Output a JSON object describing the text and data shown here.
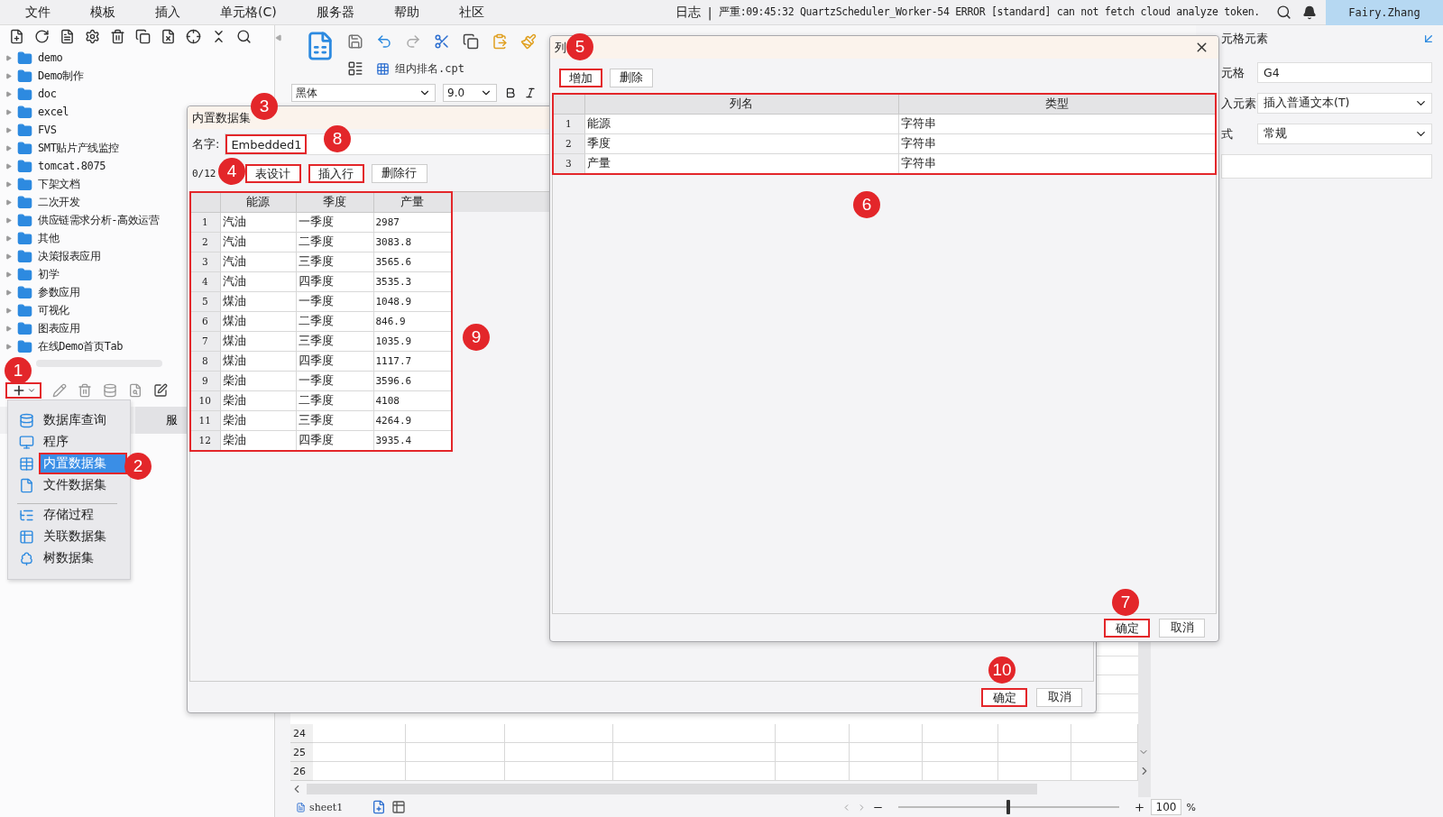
{
  "menu_bar": {
    "items": [
      "文件",
      "模板",
      "插入",
      "单元格(C)",
      "服务器",
      "帮助",
      "社区"
    ],
    "log_label": "日志",
    "separator": "|",
    "log_message": "严重:09:45:32 QuartzScheduler_Worker-54 ERROR [standard] can not fetch cloud analyze token.",
    "user": "Fairy.Zhang"
  },
  "file_tree": {
    "items": [
      {
        "name": "demo"
      },
      {
        "name": "Demo制作"
      },
      {
        "name": "doc"
      },
      {
        "name": "excel"
      },
      {
        "name": "FVS"
      },
      {
        "name": "SMT贴片产线监控"
      },
      {
        "name": "tomcat.8075"
      },
      {
        "name": "下架文档"
      },
      {
        "name": "二次开发"
      },
      {
        "name": "供应链需求分析-高效运营"
      },
      {
        "name": "其他"
      },
      {
        "name": "决策报表应用"
      },
      {
        "name": "初学"
      },
      {
        "name": "参数应用"
      },
      {
        "name": "可视化"
      },
      {
        "name": "图表应用"
      },
      {
        "name": "在线Demo首页Tab"
      }
    ]
  },
  "datasource_toolbar": {
    "add_highlighted": true,
    "tab_label": "服"
  },
  "new_dataset_menu": {
    "groups": [
      [
        {
          "label": "数据库查询",
          "selected": false,
          "highlighted": false
        },
        {
          "label": "程序",
          "selected": false,
          "highlighted": false
        },
        {
          "label": "内置数据集",
          "selected": true,
          "highlighted": true
        },
        {
          "label": "文件数据集",
          "selected": false,
          "highlighted": false
        }
      ],
      [
        {
          "label": "存储过程",
          "selected": false,
          "highlighted": false
        },
        {
          "label": "关联数据集",
          "selected": false,
          "highlighted": false
        },
        {
          "label": "树数据集",
          "selected": false,
          "highlighted": false
        }
      ]
    ]
  },
  "designer": {
    "file_tab": "组内排名.cpt",
    "font": "黑体",
    "font_size": "9.0",
    "row_numbers": [
      "24",
      "25",
      "26"
    ],
    "sheet_tab": "sheet1",
    "zoom_slider": {
      "level": 0.5
    },
    "zoom_value": "100",
    "zoom_unit": "%"
  },
  "cell_panel": {
    "title": "元格元素",
    "fields": [
      {
        "kind": "text",
        "label": "元格",
        "value": "G4"
      },
      {
        "kind": "select",
        "label": "入元素",
        "value": "插入普通文本(T)"
      },
      {
        "kind": "select",
        "label": "式",
        "value": "常规"
      },
      {
        "kind": "blank"
      }
    ]
  },
  "embedded_dialog": {
    "title": "内置数据集",
    "name_label": "名字:",
    "name_value": "Embedded1",
    "name_highlighted": true,
    "row_count": "0/12",
    "buttons": [
      {
        "label": "表设计",
        "highlighted": true
      },
      {
        "label": "插入行",
        "highlighted": true
      },
      {
        "label": "删除行",
        "highlighted": false
      }
    ],
    "table": {
      "highlighted": true,
      "columns": [
        "能源",
        "季度",
        "产量"
      ],
      "rows": [
        {
          "index": "1",
          "cells": [
            "汽油",
            "一季度",
            "2987"
          ]
        },
        {
          "index": "2",
          "cells": [
            "汽油",
            "二季度",
            "3083.8"
          ]
        },
        {
          "index": "3",
          "cells": [
            "汽油",
            "三季度",
            "3565.6"
          ]
        },
        {
          "index": "4",
          "cells": [
            "汽油",
            "四季度",
            "3535.3"
          ]
        },
        {
          "index": "5",
          "cells": [
            "煤油",
            "一季度",
            "1048.9"
          ]
        },
        {
          "index": "6",
          "cells": [
            "煤油",
            "二季度",
            "846.9"
          ]
        },
        {
          "index": "7",
          "cells": [
            "煤油",
            "三季度",
            "1035.9"
          ]
        },
        {
          "index": "8",
          "cells": [
            "煤油",
            "四季度",
            "1117.7"
          ]
        },
        {
          "index": "9",
          "cells": [
            "柴油",
            "一季度",
            "3596.6"
          ]
        },
        {
          "index": "10",
          "cells": [
            "柴油",
            "二季度",
            "4108"
          ]
        },
        {
          "index": "11",
          "cells": [
            "柴油",
            "三季度",
            "4264.9"
          ]
        },
        {
          "index": "12",
          "cells": [
            "柴油",
            "四季度",
            "3935.4"
          ]
        }
      ]
    },
    "footer_buttons": [
      {
        "label": "确定",
        "highlighted": true
      },
      {
        "label": "取消",
        "highlighted": false
      }
    ]
  },
  "column_dialog": {
    "title": "列",
    "toolbar_buttons": [
      {
        "label": "增加",
        "highlighted": true
      },
      {
        "label": "删除",
        "highlighted": false
      }
    ],
    "table": {
      "highlighted": true,
      "columns": [
        "列名",
        "类型"
      ],
      "rows": [
        {
          "index": "1",
          "cells": [
            "能源",
            "字符串"
          ]
        },
        {
          "index": "2",
          "cells": [
            "季度",
            "字符串"
          ]
        },
        {
          "index": "3",
          "cells": [
            "产量",
            "字符串"
          ]
        }
      ]
    },
    "footer_buttons": [
      {
        "label": "确定",
        "highlighted": true
      },
      {
        "label": "取消",
        "highlighted": false
      }
    ]
  },
  "annotations": [
    {
      "label": "1"
    },
    {
      "label": "2"
    },
    {
      "label": "3"
    },
    {
      "label": "4"
    },
    {
      "label": "5"
    },
    {
      "label": "6"
    },
    {
      "label": "7"
    },
    {
      "label": "8"
    },
    {
      "label": "9"
    },
    {
      "label": "10"
    }
  ]
}
